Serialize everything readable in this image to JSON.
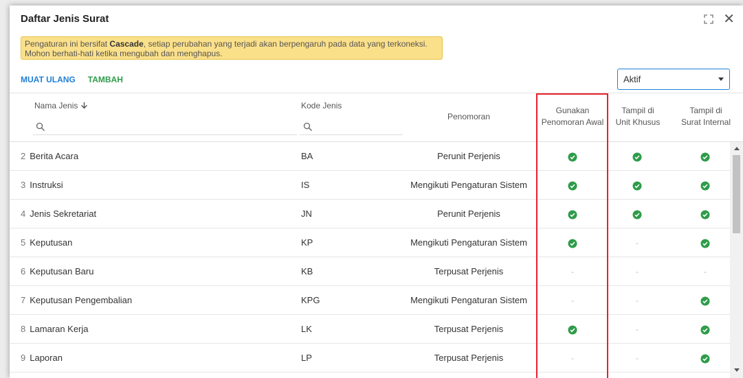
{
  "dialog": {
    "title": "Daftar Jenis Surat",
    "warning": {
      "prefix": "Pengaturan ini bersifat ",
      "bold": "Cascade",
      "suffix": ", setiap perubahan yang terjadi akan berpengaruh pada data yang terkoneksi.",
      "line2": "Mohon berhati-hati ketika mengubah dan menghapus."
    }
  },
  "toolbar": {
    "reload_label": "MUAT ULANG",
    "add_label": "TAMBAH"
  },
  "filter": {
    "selected": "Aktif"
  },
  "columns": {
    "name": "Nama Jenis",
    "code": "Kode Jenis",
    "numbering": "Penomoran",
    "initial_numbering_1": "Gunakan",
    "initial_numbering_2": "Penomoran Awal",
    "unit_1": "Tampil di",
    "unit_2": "Unit Khusus",
    "internal_1": "Tampil di",
    "internal_2": "Surat Internal"
  },
  "colors": {
    "check": "#2e9c4a",
    "highlight": "#e8202a",
    "accent": "#1e7fd6"
  },
  "rows": [
    {
      "no": "2",
      "name": "Berita Acara",
      "code": "BA",
      "numbering": "Perunit Perjenis",
      "initial": true,
      "unit": true,
      "internal": true
    },
    {
      "no": "3",
      "name": "Instruksi",
      "code": "IS",
      "numbering": "Mengikuti Pengaturan Sistem",
      "initial": true,
      "unit": true,
      "internal": true
    },
    {
      "no": "4",
      "name": "Jenis Sekretariat",
      "code": "JN",
      "numbering": "Perunit Perjenis",
      "initial": true,
      "unit": true,
      "internal": true
    },
    {
      "no": "5",
      "name": "Keputusan",
      "code": "KP",
      "numbering": "Mengikuti Pengaturan Sistem",
      "initial": true,
      "unit": false,
      "internal": true
    },
    {
      "no": "6",
      "name": "Keputusan Baru",
      "code": "KB",
      "numbering": "Terpusat Perjenis",
      "initial": false,
      "unit": false,
      "internal": false
    },
    {
      "no": "7",
      "name": "Keputusan Pengembalian",
      "code": "KPG",
      "numbering": "Mengikuti Pengaturan Sistem",
      "initial": false,
      "unit": false,
      "internal": true
    },
    {
      "no": "8",
      "name": "Lamaran Kerja",
      "code": "LK",
      "numbering": "Terpusat Perjenis",
      "initial": true,
      "unit": false,
      "internal": true
    },
    {
      "no": "9",
      "name": "Laporan",
      "code": "LP",
      "numbering": "Terpusat Perjenis",
      "initial": false,
      "unit": false,
      "internal": true
    }
  ],
  "empty_marker": "-"
}
